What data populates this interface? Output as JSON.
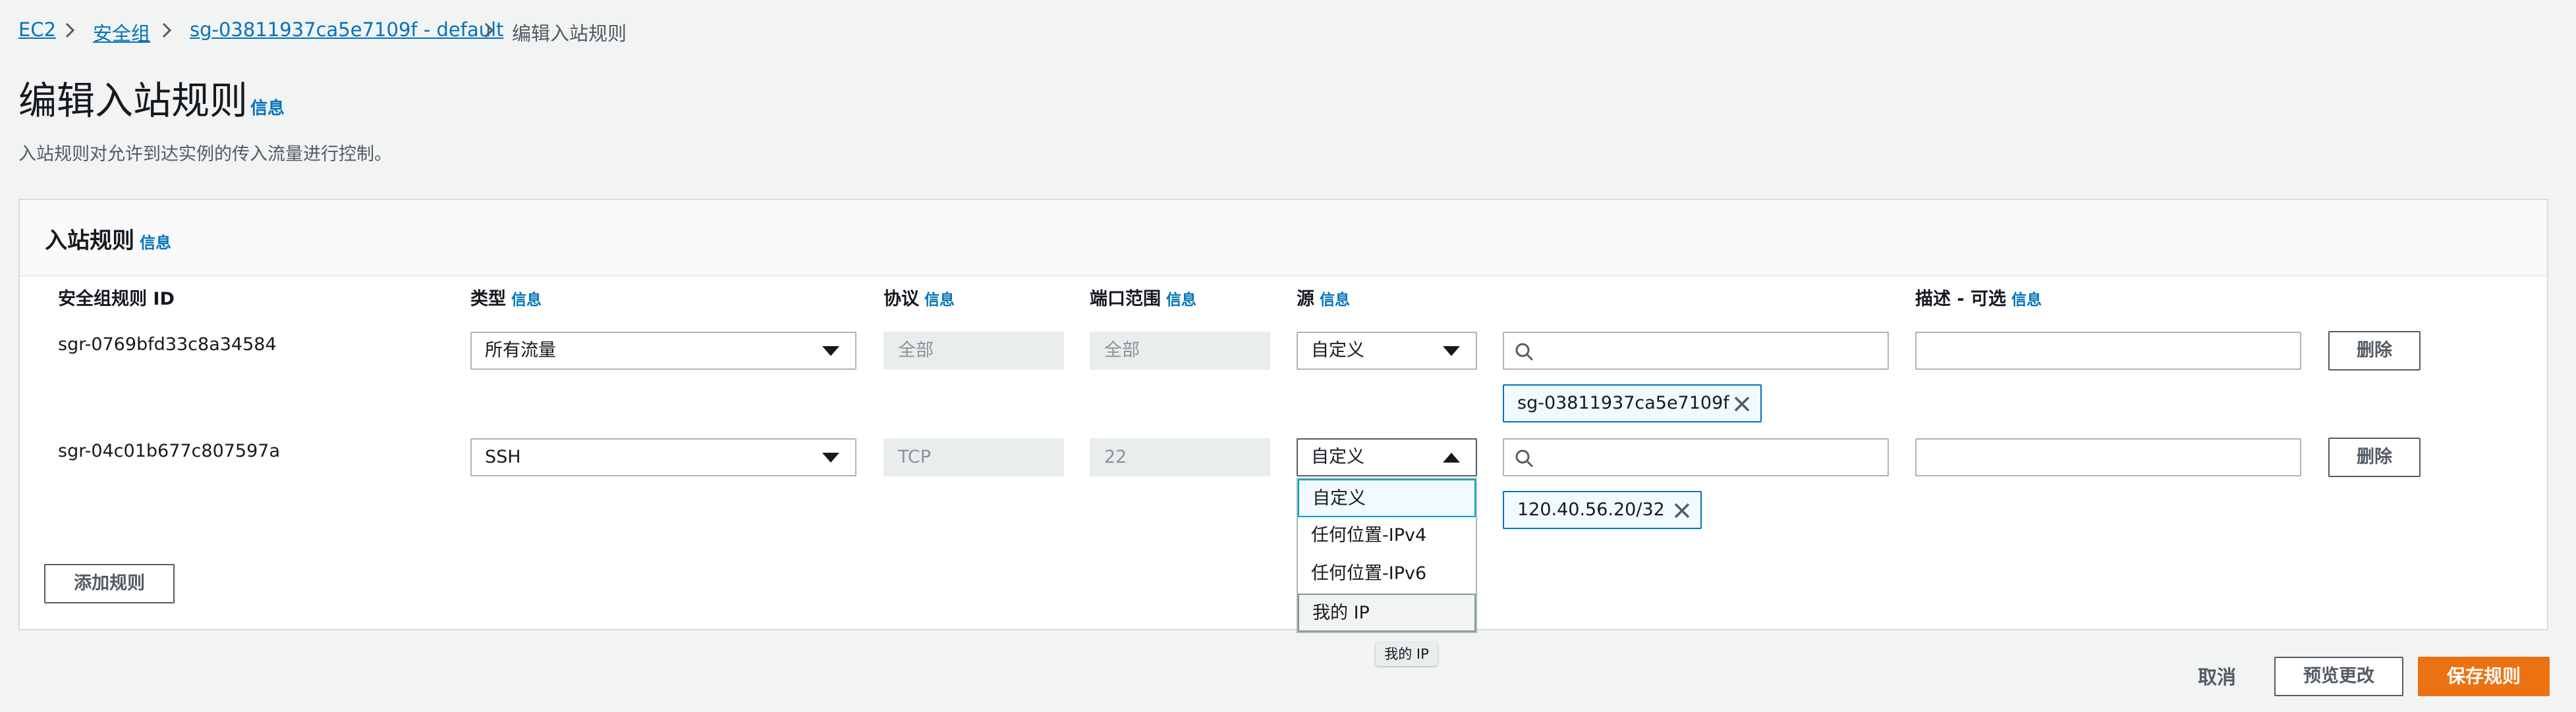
{
  "breadcrumb": {
    "items": [
      "EC2",
      "安全组",
      "sg-03811937ca5e7109f - default",
      "编辑入站规则"
    ]
  },
  "page": {
    "title": "编辑入站规则",
    "title_info": "信息",
    "description": "入站规则对允许到达实例的传入流量进行控制。"
  },
  "panel": {
    "title": "入站规则",
    "title_info": "信息",
    "columns": {
      "rule_id": "安全组规则 ID",
      "type": "类型",
      "protocol": "协议",
      "port_range": "端口范围",
      "source": "源",
      "description": "描述 - 可选",
      "info": "信息"
    },
    "rows": [
      {
        "rule_id": "sgr-0769bfd33c8a34584",
        "type": "所有流量",
        "protocol": "全部",
        "port_range": "全部",
        "source": "自定义",
        "search_value": "",
        "token": "sg-03811937ca5e7109f",
        "description_value": "",
        "delete_label": "删除"
      },
      {
        "rule_id": "sgr-04c01b677c807597a",
        "type": "SSH",
        "protocol": "TCP",
        "port_range": "22",
        "source": "自定义",
        "search_value": "",
        "token": "120.40.56.20/32",
        "description_value": "",
        "delete_label": "删除"
      }
    ],
    "add_rule_label": "添加规则"
  },
  "source_dropdown": {
    "options": [
      "自定义",
      "任何位置-IPv4",
      "任何位置-IPv6",
      "我的 IP"
    ],
    "selected": "自定义",
    "hovered": "我的 IP",
    "tooltip": "我的 IP"
  },
  "footer": {
    "cancel_label": "取消",
    "preview_label": "预览更改",
    "save_label": "保存规则"
  },
  "colors": {
    "link": "#0073bb",
    "primary": "#ec7211",
    "background": "#f2f3f3",
    "token_border": "#0073bb"
  }
}
